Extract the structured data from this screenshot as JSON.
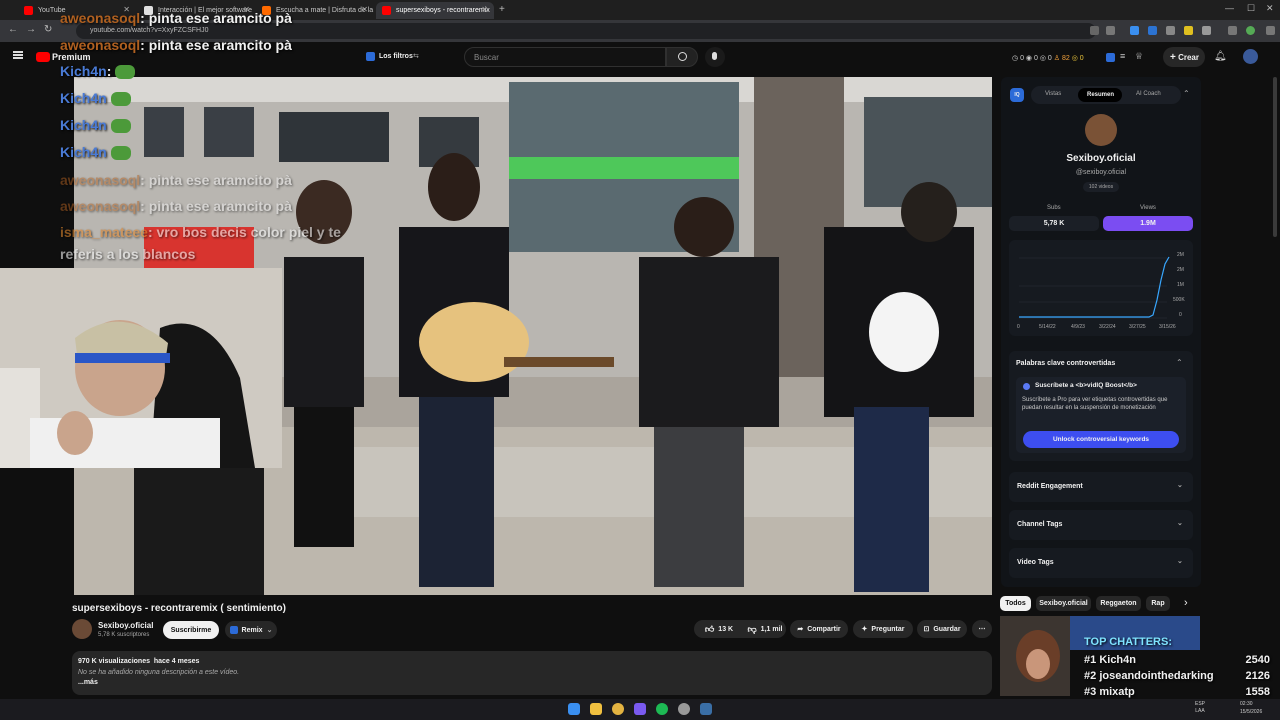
{
  "browser": {
    "tabs": [
      {
        "label": "YouTube",
        "color": "#ff0000"
      },
      {
        "label": "Interacción | El mejor software",
        "color": "#ffffff"
      },
      {
        "label": "Escucha a mate | Disfruta de la",
        "color": "#ff6a00"
      },
      {
        "label": "supersexiboys - recontraremix",
        "color": "#ff0000"
      }
    ],
    "new_tab": "+",
    "url": "youtube.com/watch?v=XxyFZCSFHJ0"
  },
  "youtube": {
    "logo": "Premium",
    "filter_label": "Los filtros",
    "search_placeholder": "Buscar",
    "header_stats": [
      "0",
      "0",
      "0",
      "82",
      "0"
    ],
    "create_label": "Crear"
  },
  "chat": [
    {
      "user": "aweonasoql",
      "text": ": pinta ese aramcito pà"
    },
    {
      "user": "aweonasoql",
      "text": ": pinta ese aramcito pà"
    },
    {
      "user": "Kich4n",
      "text": ":"
    },
    {
      "user": "Kich4n",
      "text": ""
    },
    {
      "user": "Kich4n",
      "text": ""
    },
    {
      "user": "Kich4n",
      "text": ""
    },
    {
      "user": "aweonasoql",
      "text": ": pinta ese aramcito pà"
    },
    {
      "user": "aweonasoql",
      "text": ": pinta ese aramcito pà"
    },
    {
      "user": "isma_mateee",
      "text": ": vro bos decis color piel y te"
    },
    {
      "user": "",
      "text": "referis a los blancos"
    }
  ],
  "video": {
    "title": "supersexiboys - recontraremix ( sentimiento)",
    "channel": "Sexiboy.oficial",
    "subscribers": "5,78 K suscriptores",
    "subscribe_label": "Suscribirme",
    "remix_label": "Remix",
    "likes": "13 K",
    "dislikes": "1,1 mil",
    "share_label": "Compartir",
    "ask_label": "Preguntar",
    "save_label": "Guardar",
    "views": "970 K visualizaciones",
    "age": "hace 4 meses",
    "description": "No se ha añadido ninguna descripción a este vídeo.",
    "more": "...más"
  },
  "vidiq": {
    "tabs": [
      "Vistas",
      "Resumen",
      "AI Coach"
    ],
    "channel_name": "Sexiboy.oficial",
    "handle": "@sexiboy.oficial",
    "videos": "102 videos",
    "subs_label": "Subs",
    "subs_value": "5,78 K",
    "views_label": "Views",
    "views_value": "1.9M",
    "chart_y": [
      "2M",
      "2M",
      "1M",
      "500K",
      "0"
    ],
    "chart_x": [
      "0",
      "5/14/22",
      "4/9/23",
      "3/22/24",
      "3/27/25",
      "3/15/26"
    ],
    "keywords_title": "Palabras clave controvertidas",
    "boost_title": "Suscríbete a <b>vidIQ Boost</b>",
    "boost_text": "Suscríbete a Pro para ver etiquetas controvertidas que puedan resultar en la suspensión de monetización",
    "unlock_label": "Unlock controversial keywords",
    "sections": [
      "Reddit Engagement",
      "Channel Tags",
      "Video Tags"
    ]
  },
  "chips": [
    "Todos",
    "Sexiboy.oficial",
    "Reggaeton",
    "Rap"
  ],
  "top_chatters": {
    "title": "TOP CHATTERS:",
    "rows": [
      {
        "rank": "#1",
        "name": "Kich4n",
        "count": "2540"
      },
      {
        "rank": "#2",
        "name": "joseandointhedarking",
        "count": "2126"
      },
      {
        "rank": "#3",
        "name": "mixatp",
        "count": "1558"
      }
    ]
  },
  "taskbar": {
    "lang": "ESP LAA",
    "time": "02:30",
    "date": "15/5/2026"
  }
}
